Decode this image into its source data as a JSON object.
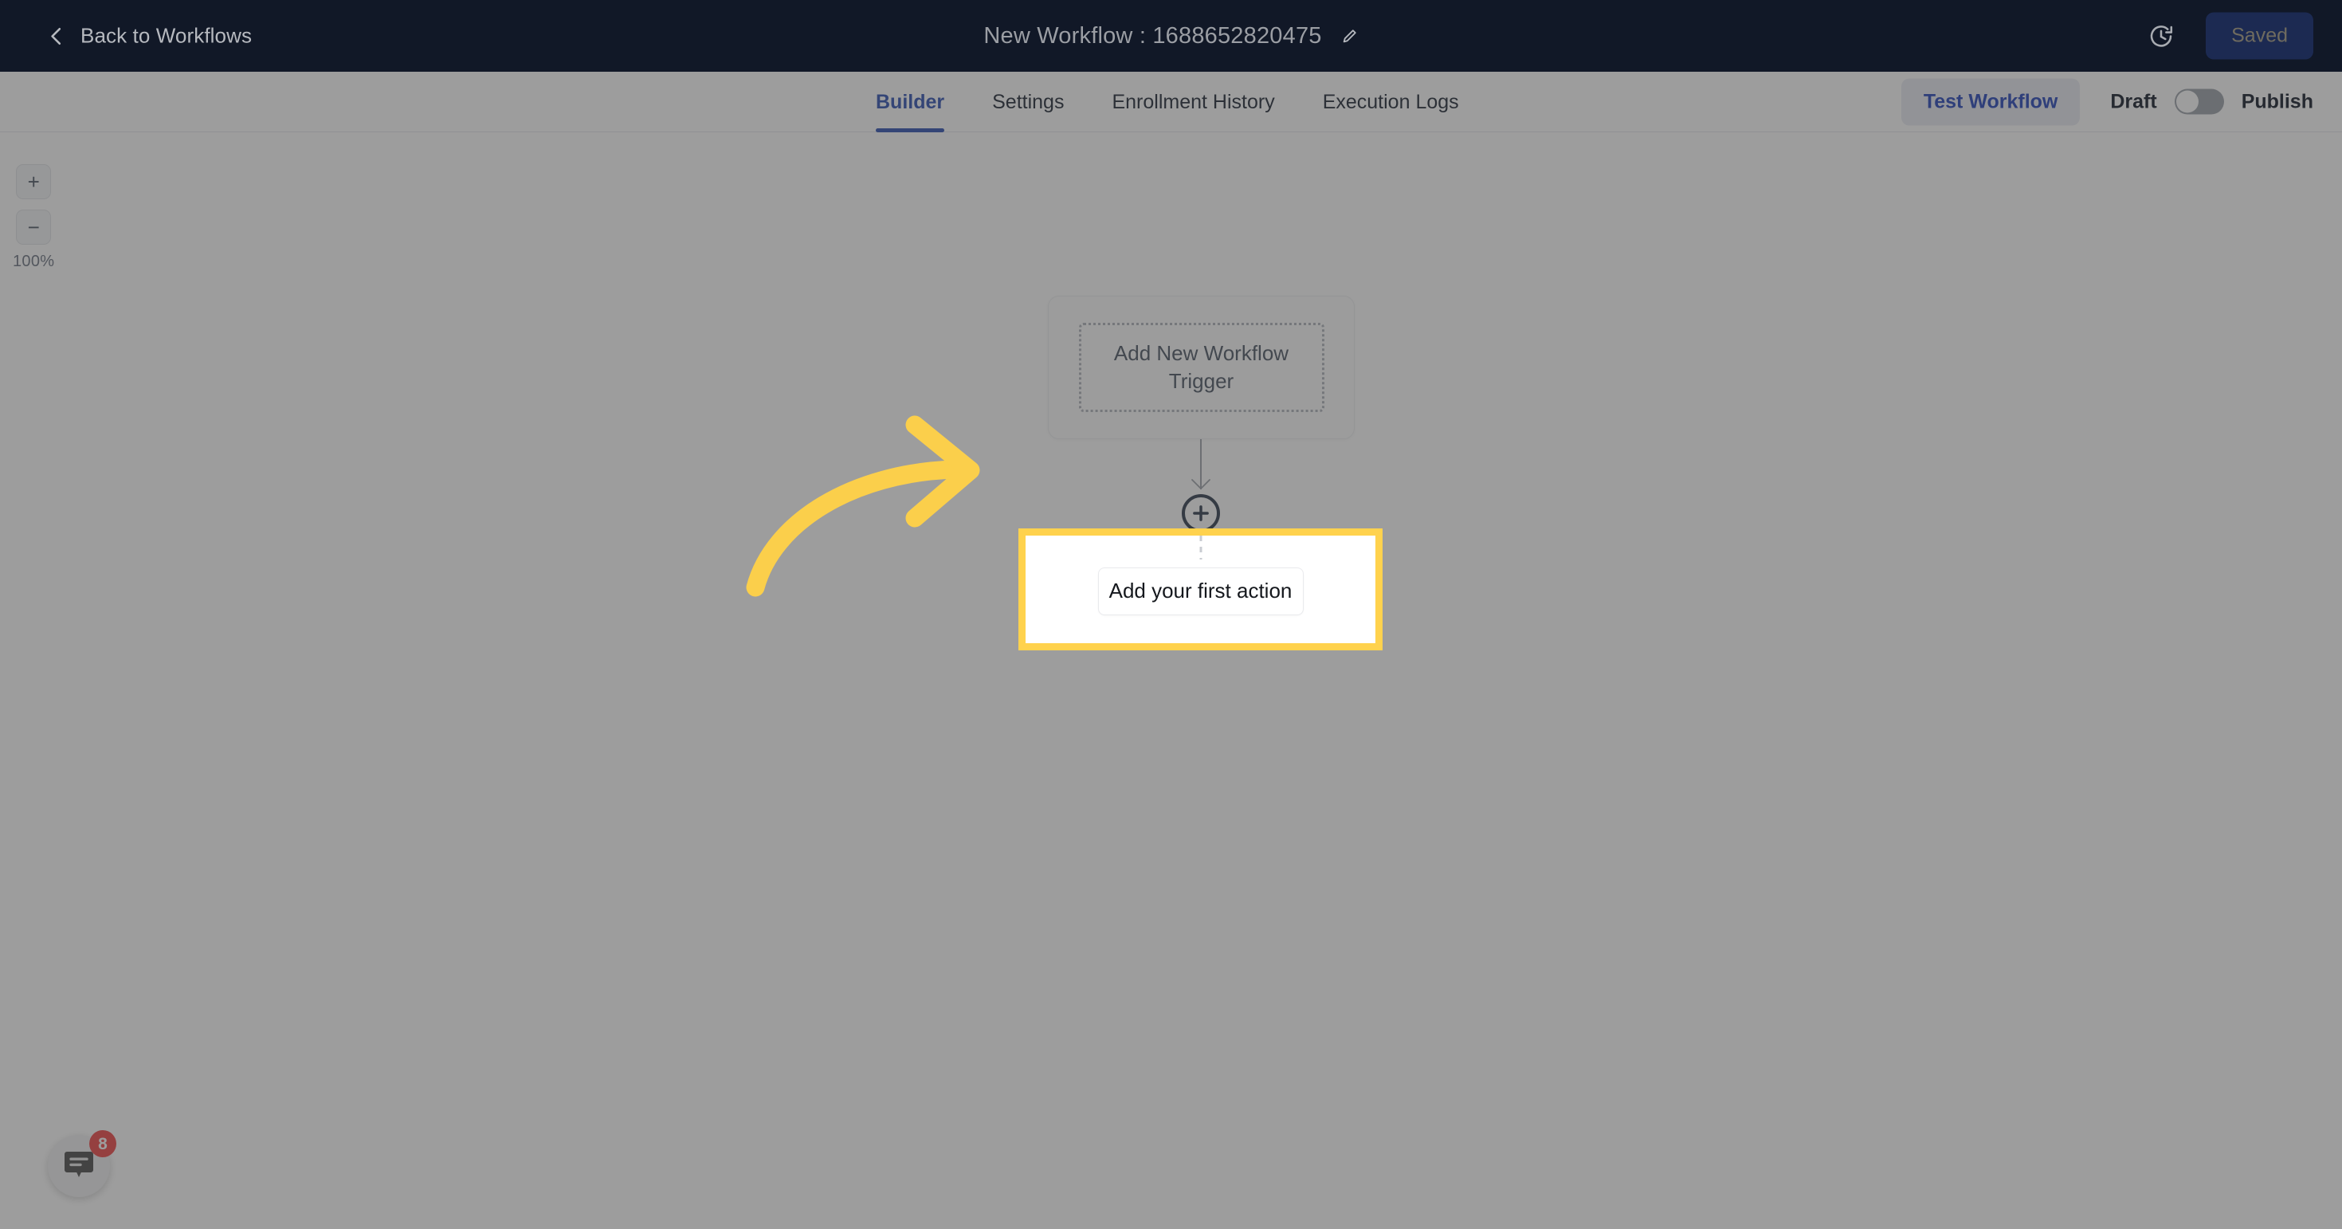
{
  "topbar": {
    "back_label": "Back to Workflows",
    "back_icon": "chevron-left-icon",
    "title": "New Workflow : 1688652820475",
    "edit_icon": "pencil-icon",
    "history_icon": "revision-history-clock-icon",
    "save_button_label": "Saved",
    "bg_color": "#111827",
    "save_button_color": "#1C2A52"
  },
  "tabbar": {
    "tabs": [
      {
        "label": "Builder",
        "active": true
      },
      {
        "label": "Settings",
        "active": false
      },
      {
        "label": "Enrollment History",
        "active": false
      },
      {
        "label": "Execution Logs",
        "active": false
      }
    ],
    "active_tab_color": "#2D4FB0",
    "test_workflow_label": "Test Workflow",
    "draft_label": "Draft",
    "publish_label": "Publish",
    "publish_toggle_state": "off"
  },
  "canvas": {
    "zoom": {
      "zoom_in_label": "+",
      "zoom_out_label": "−",
      "level_label": "100%"
    },
    "trigger_node": {
      "label": "Add New Workflow Trigger"
    },
    "add_step_button": {
      "icon": "plus-circle-icon"
    },
    "action_node": {
      "label": "Add your first action",
      "highlight_color": "#FFD24D",
      "highlighted": true
    }
  },
  "annotation": {
    "arrow_icon": "curved-arrow-right-icon",
    "arrow_color": "#FBCF4B",
    "points_to": "Add your first action"
  },
  "chat_widget": {
    "icon": "chat-bubble-icon",
    "unread_count": "8",
    "badge_color": "#EF4444"
  },
  "overlay": {
    "dim_color": "rgba(60,60,60,0.50)",
    "spotlight_target": "action_node"
  }
}
